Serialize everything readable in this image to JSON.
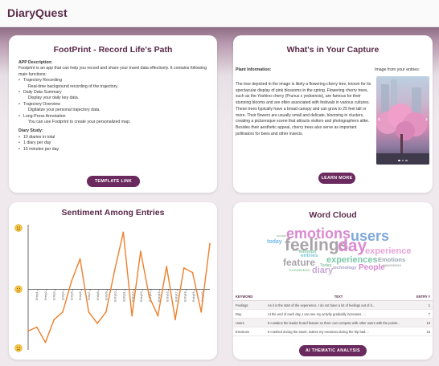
{
  "app": {
    "title": "DiaryQuest"
  },
  "footprint": {
    "title": "FootPrint - Record Life's Path",
    "app_desc_label": "APP Description:",
    "app_desc": "Footprint is an app that can help you record and share your travel data effectively. It contains following main functions:",
    "features": [
      {
        "name": "Trajectory Recording",
        "desc": "Real-time background recording of the trajectory."
      },
      {
        "name": "Daily Data Summary",
        "desc": "Display your daily key data."
      },
      {
        "name": "Trajectory Overview",
        "desc": "Digitalize your personal trajectory data."
      },
      {
        "name": "Long-Press Annotation",
        "desc": "You can use Footprint to create your personalized map."
      }
    ],
    "study_label": "Diary Study:",
    "study_items": [
      "10 diaries in total",
      "1 diary per day",
      "15 minutes per day"
    ],
    "button": "TEMPLATE LINK"
  },
  "capture": {
    "title": "What's in Your Capture",
    "info_label": "Plant Information:",
    "image_label": "Image from your entries:",
    "info_text": "The tree depicted in the image is likely a flowering cherry tree, known for its spectacular display of pink blossoms in the spring. Flowering cherry trees, such as the Yoshino cherry (Prunus x yedoensis), are famous for their stunning blooms and are often associated with festivals in various cultures. These trees typically have a broad canopy and can grow to 25 feet tall or more. Their flowers are usually small and delicate, blooming in clusters, creating a picturesque scene that attracts visitors and photographers alike. Besides their aesthetic appeal, cherry trees also serve as important pollinators for bees and other insects.",
    "button": "LEARN MORE",
    "carousel_prev": "‹",
    "carousel_next": "›"
  },
  "sentiment": {
    "title": "Sentiment Among Entries"
  },
  "chart_data": {
    "type": "line",
    "title": "Sentiment Among Entries",
    "x": [
      "Entry1",
      "Entry2",
      "Entry3",
      "Entry4",
      "Entry5",
      "Entry6",
      "Entry7",
      "Entry8",
      "Entry9",
      "Entry10",
      "Entry11",
      "Entry12",
      "Entry13",
      "Entry14",
      "Entry15",
      "Entry16",
      "Entry17",
      "Entry18",
      "Entry19",
      "Entry20"
    ],
    "series": [
      {
        "values": [
          -0.55,
          -0.5,
          -0.7,
          -0.4,
          -0.3,
          0.1,
          0.4,
          -0.3,
          -0.45,
          -0.3,
          0.25,
          0.75,
          -0.35,
          0.5,
          -0.1,
          -0.35,
          0.3,
          -0.4,
          0.28,
          0.22,
          -0.3,
          0.6
        ]
      }
    ],
    "ylim": [
      -0.8,
      0.85
    ],
    "color": "#ef7f2a",
    "y_markers": [
      "positive-emoji",
      "neutral-emoji",
      "negative-emoji"
    ]
  },
  "wordcloud": {
    "title": "Word Cloud",
    "words": [
      {
        "text": "emotions",
        "color": "#d98ad0"
      },
      {
        "text": "users",
        "color": "#7fa8d9"
      },
      {
        "text": "feelings",
        "color": "#a8a3a7"
      },
      {
        "text": "day",
        "color": "#d98ad0"
      },
      {
        "text": "experience",
        "color": "#e9a4d8"
      },
      {
        "text": "experiences",
        "color": "#7cc8a8"
      },
      {
        "text": "Emotions",
        "color": "#9aa7b4"
      },
      {
        "text": "feature",
        "color": "#a8a3a7"
      },
      {
        "text": "People",
        "color": "#d98ad0"
      },
      {
        "text": "today",
        "color": "#6fb8e6"
      },
      {
        "text": "entries",
        "color": "#7cc8d8"
      },
      {
        "text": "diary",
        "color": "#c9a8d8"
      },
      {
        "text": "technology",
        "color": "#a6a0c8"
      },
      {
        "text": "awareness",
        "color": "#b0b0b0"
      },
      {
        "text": "connection",
        "color": "#9ad0a0"
      },
      {
        "text": "emotion",
        "color": "#7cc8a8"
      },
      {
        "text": "Today",
        "color": "#8fc0a8"
      },
      {
        "text": "moods",
        "color": "#a0c8a0"
      },
      {
        "text": "icons",
        "color": "#b0b0b0"
      }
    ],
    "table": {
      "headers": [
        "KEYWORD",
        "TEXT",
        "ENTRY #"
      ],
      "rows": [
        {
          "keyword": "Feelings",
          "text": "As it is the start of the experience, I do not have a lot of feelings out of it...",
          "entry": "1"
        },
        {
          "keyword": "Day",
          "text": "At the end of each day, I can see my activity gradually increases. ...",
          "entry": "7"
        },
        {
          "keyword": "Users",
          "text": "It contains the leader board feature so that I can compete with other users with the points...",
          "entry": "10"
        },
        {
          "keyword": "Emotions",
          "text": "It crashed during the travel, makes my emotions during the trip bad....",
          "entry": "16"
        }
      ]
    },
    "button": "AI THEMATIC ANALYSIS"
  }
}
